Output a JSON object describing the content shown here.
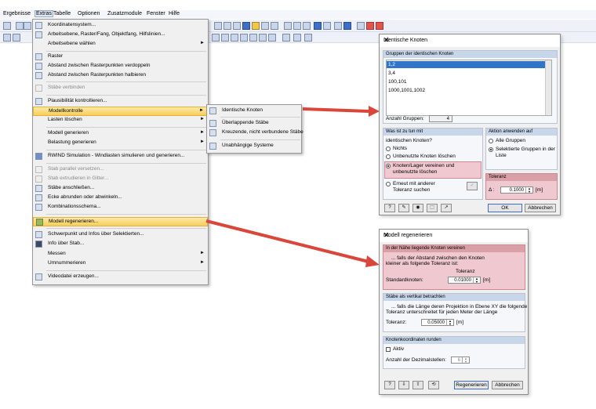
{
  "menubar": [
    "Ergebnisse",
    "Extras",
    "Tabelle",
    "Optionen",
    "Zusatzmodule",
    "Fenster",
    "Hilfe"
  ],
  "menu": {
    "items": [
      {
        "label": "Koordinatensystem...",
        "icon": "coordinate-system-icon"
      },
      {
        "label": "Arbeitsebene, Raster/Fang, Objektfang, Hilfslinien...",
        "icon": "work-plane-icon"
      },
      {
        "label": "Arbeitsebene wählen",
        "icon": "",
        "arrow": "►"
      },
      {
        "label": "Raster",
        "icon": "grid-icon"
      },
      {
        "label": "Abstand zwischen Rasterpunkten verdoppeln",
        "icon": "grid-double-icon"
      },
      {
        "label": "Abstand zwischen Rasterpunkten halbieren",
        "icon": "grid-half-icon"
      },
      {
        "label": "Stäbe verbinden",
        "icon": "connect-members-icon"
      },
      {
        "label": "Plausibilität kontrollieren...",
        "icon": "plausibility-check-icon"
      },
      {
        "label": "Modellkontrolle",
        "icon": "",
        "arrow": "►"
      },
      {
        "label": "Lasten löschen",
        "icon": "",
        "arrow": "►"
      },
      {
        "label": "Modell generieren",
        "icon": "",
        "arrow": "►"
      },
      {
        "label": "Belastung generieren",
        "icon": "",
        "arrow": "►"
      },
      {
        "label": "RWIND Simulation - Windlasten simulieren und generieren...",
        "icon": "rwind-icon"
      },
      {
        "label": "Stab parallel versetzen...",
        "icon": "offset-member-icon"
      },
      {
        "label": "Stab extrudieren in Gitter...",
        "icon": "extrude-member-icon"
      },
      {
        "label": "Stäbe anschließen...",
        "icon": "join-members-icon"
      },
      {
        "label": "Ecke abrunden oder abwinkeln...",
        "icon": "round-corner-icon"
      },
      {
        "label": "Kombinationsschema...",
        "icon": "combination-scheme-icon"
      },
      {
        "label": "Modell regenerieren...",
        "icon": "regenerate-model-icon"
      },
      {
        "label": "Schwerpunkt und Infos über Selektierten...",
        "icon": "centroid-icon"
      },
      {
        "label": "Info über Stab...",
        "icon": "member-info-icon"
      },
      {
        "label": "Messen",
        "icon": "",
        "arrow": "►"
      },
      {
        "label": "Umnummerieren",
        "icon": "",
        "arrow": "►"
      },
      {
        "label": "Videodatei erzeugen...",
        "icon": "video-icon"
      }
    ]
  },
  "submenu": {
    "items": [
      {
        "label": "Identische Knoten",
        "icon": "identical-nodes-icon"
      },
      {
        "label": "Überlappende Stäbe",
        "icon": "overlapping-members-icon"
      },
      {
        "label": "Kreuzende, nicht verbundene Stäbe",
        "icon": "crossing-members-icon"
      },
      {
        "label": "Unabhängige Systeme",
        "icon": "independent-systems-icon"
      }
    ]
  },
  "dialog1": {
    "title": "Identische Knoten",
    "close": "✕",
    "group_header": "Gruppen der identischen Knoten",
    "list": [
      "1,2",
      "3,4",
      "100,101",
      "1000,1001,1002"
    ],
    "count_label": "Anzahl Gruppen:",
    "count_value": "4",
    "what_header": "Was ist zu tun mit",
    "what_sub": "identischen Knoten?",
    "options": [
      "Nichts",
      "Unbenutzte Knoten löschen",
      "Knoten/Lager vereinen und unbenutzte löschen",
      "Erneut mit anderer Toleranz suchen"
    ],
    "apply_header": "Aktion anwenden auf",
    "apply_options": [
      "Alle Gruppen",
      "Selektierte Gruppen in der Liste"
    ],
    "tolerance_header": "Toleranz",
    "tolerance_delta": "Δ :",
    "tolerance_value": "0.1000",
    "tolerance_unit": "[m]",
    "ok": "OK",
    "cancel": "Abbrechen"
  },
  "dialog2": {
    "title": "Modell regenerieren",
    "close": "✕",
    "g1_header": "In der Nähe liegende Knoten vereinen",
    "g1_text1": "... falls der Abstand zwischen den Knoten",
    "g1_text2": "kleiner als folgende Toleranz ist:",
    "g1_col": "Toleranz",
    "g1_label": "Standardknoten:",
    "g1_value": "0.01000",
    "g1_unit": "[m]",
    "g2_header": "Stäbe als vertikal betrachten",
    "g2_text1": "... falls die Länge deren Projektion in Ebene XY die folgende",
    "g2_text2": "Toleranz unterschreitet für jeden Meter der Länge",
    "g2_label": "Toleranz:",
    "g2_value": "0.05000",
    "g2_unit": "[m]",
    "g3_header": "Knotenkoordinaten runden",
    "g3_check": "Aktiv",
    "g3_label": "Anzahl der Dezimalstellen:",
    "g3_value": "6",
    "regen": "Regenerieren",
    "cancel": "Abbrechen"
  },
  "colors": {
    "arrow": "#d9463a",
    "highlight": "#f7ce5a",
    "selection": "#2f76c9",
    "pink": "#efc9cf"
  }
}
